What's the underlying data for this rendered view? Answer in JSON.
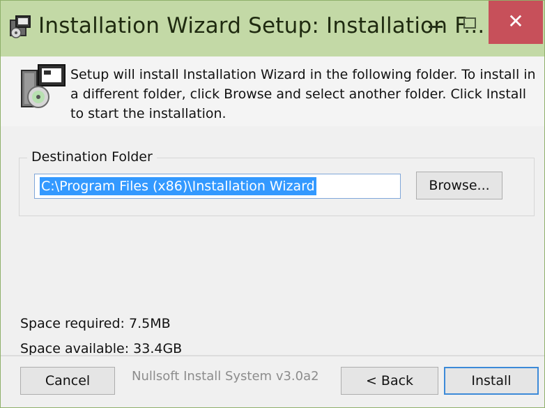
{
  "window": {
    "title": "Installation Wizard Setup: Installation F...",
    "close_glyph": "✕",
    "icons": {
      "title_icon": "installer-icon",
      "minimize": "minimize-icon",
      "maximize": "maximize-icon",
      "close": "close-icon"
    }
  },
  "header": {
    "icon": "setup-disk-icon",
    "description": "Setup will install Installation Wizard in the following folder. To install in a different folder, click Browse and select another folder. Click Install to start the installation."
  },
  "destination": {
    "group_label": "Destination Folder",
    "path": "C:\\Program Files (x86)\\Installation Wizard",
    "browse_label": "Browse..."
  },
  "space": {
    "required": "Space required: 7.5MB",
    "available": "Space available: 33.4GB"
  },
  "footer": {
    "branding": "Nullsoft Install System v3.0a2",
    "cancel_label": "Cancel",
    "back_label": "< Back",
    "install_label": "Install"
  },
  "colors": {
    "titlebar": "#c3d9a6",
    "close_button": "#c7505a",
    "selection": "#3399ff",
    "focus_border": "#3c8ad8"
  }
}
